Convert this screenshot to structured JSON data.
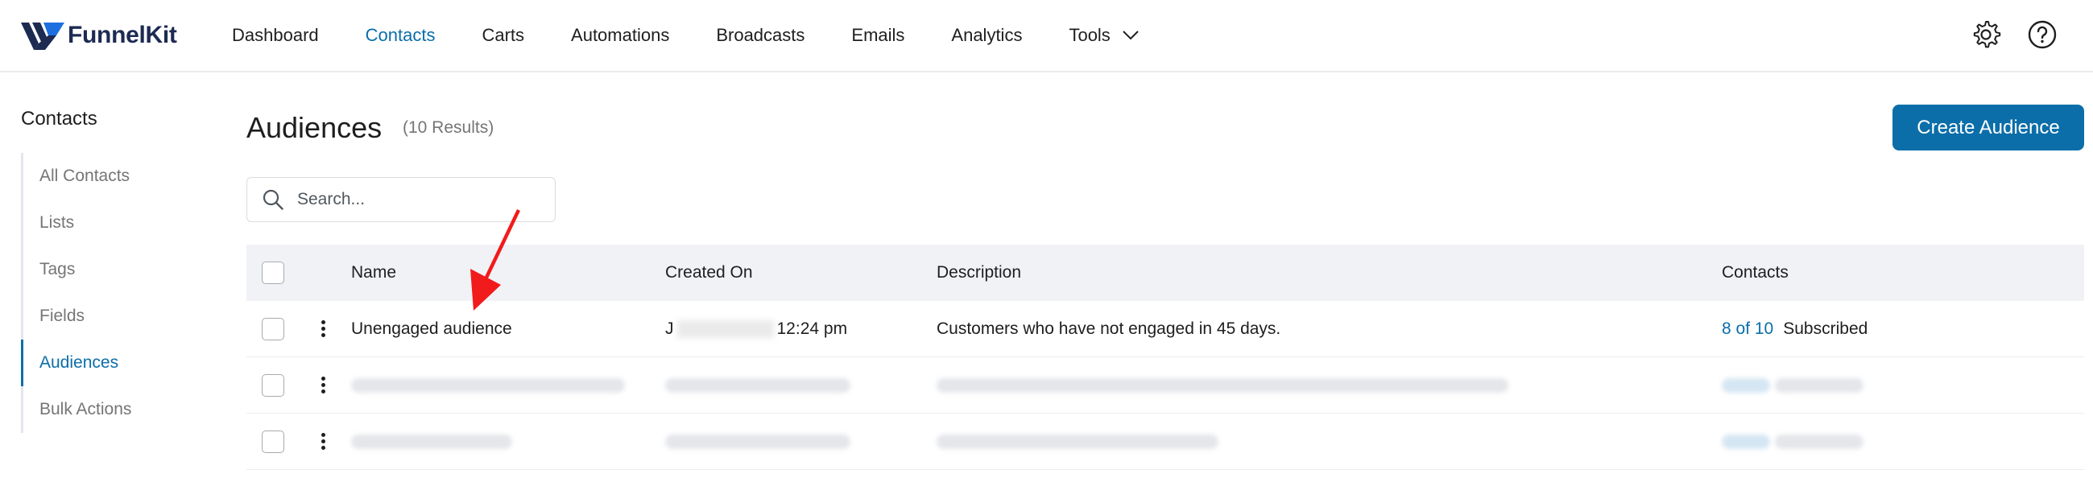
{
  "brand": {
    "name_part1": "Funnel",
    "name_part2": "Kit",
    "logo_icon": "funnelkit-logo-icon"
  },
  "nav": {
    "items": [
      {
        "label": "Dashboard",
        "active": false
      },
      {
        "label": "Contacts",
        "active": true
      },
      {
        "label": "Carts",
        "active": false
      },
      {
        "label": "Automations",
        "active": false
      },
      {
        "label": "Broadcasts",
        "active": false
      },
      {
        "label": "Emails",
        "active": false
      },
      {
        "label": "Analytics",
        "active": false
      },
      {
        "label": "Tools",
        "active": false,
        "dropdown": true
      }
    ],
    "icons": [
      "gear-icon",
      "help-icon"
    ]
  },
  "sidebar": {
    "title": "Contacts",
    "items": [
      {
        "label": "All Contacts",
        "active": false
      },
      {
        "label": "Lists",
        "active": false
      },
      {
        "label": "Tags",
        "active": false
      },
      {
        "label": "Fields",
        "active": false
      },
      {
        "label": "Audiences",
        "active": true
      },
      {
        "label": "Bulk Actions",
        "active": false
      }
    ]
  },
  "main": {
    "title": "Audiences",
    "result_count": "(10 Results)",
    "create_button": "Create Audience",
    "search": {
      "placeholder": "Search...",
      "value": ""
    }
  },
  "table": {
    "headers": {
      "name": "Name",
      "created": "Created On",
      "description": "Description",
      "contacts": "Contacts"
    },
    "rows": [
      {
        "name": "Unengaged audience",
        "created_prefix": "J",
        "created_time": "12:24 pm",
        "description": "Customers who have not engaged in 45 days.",
        "contacts_count": "8 of 10",
        "contacts_status": "Subscribed"
      }
    ]
  },
  "colors": {
    "accent": "#0b6ea9",
    "arrow": "#f21b1b",
    "header_bg": "#f0f2f6"
  }
}
